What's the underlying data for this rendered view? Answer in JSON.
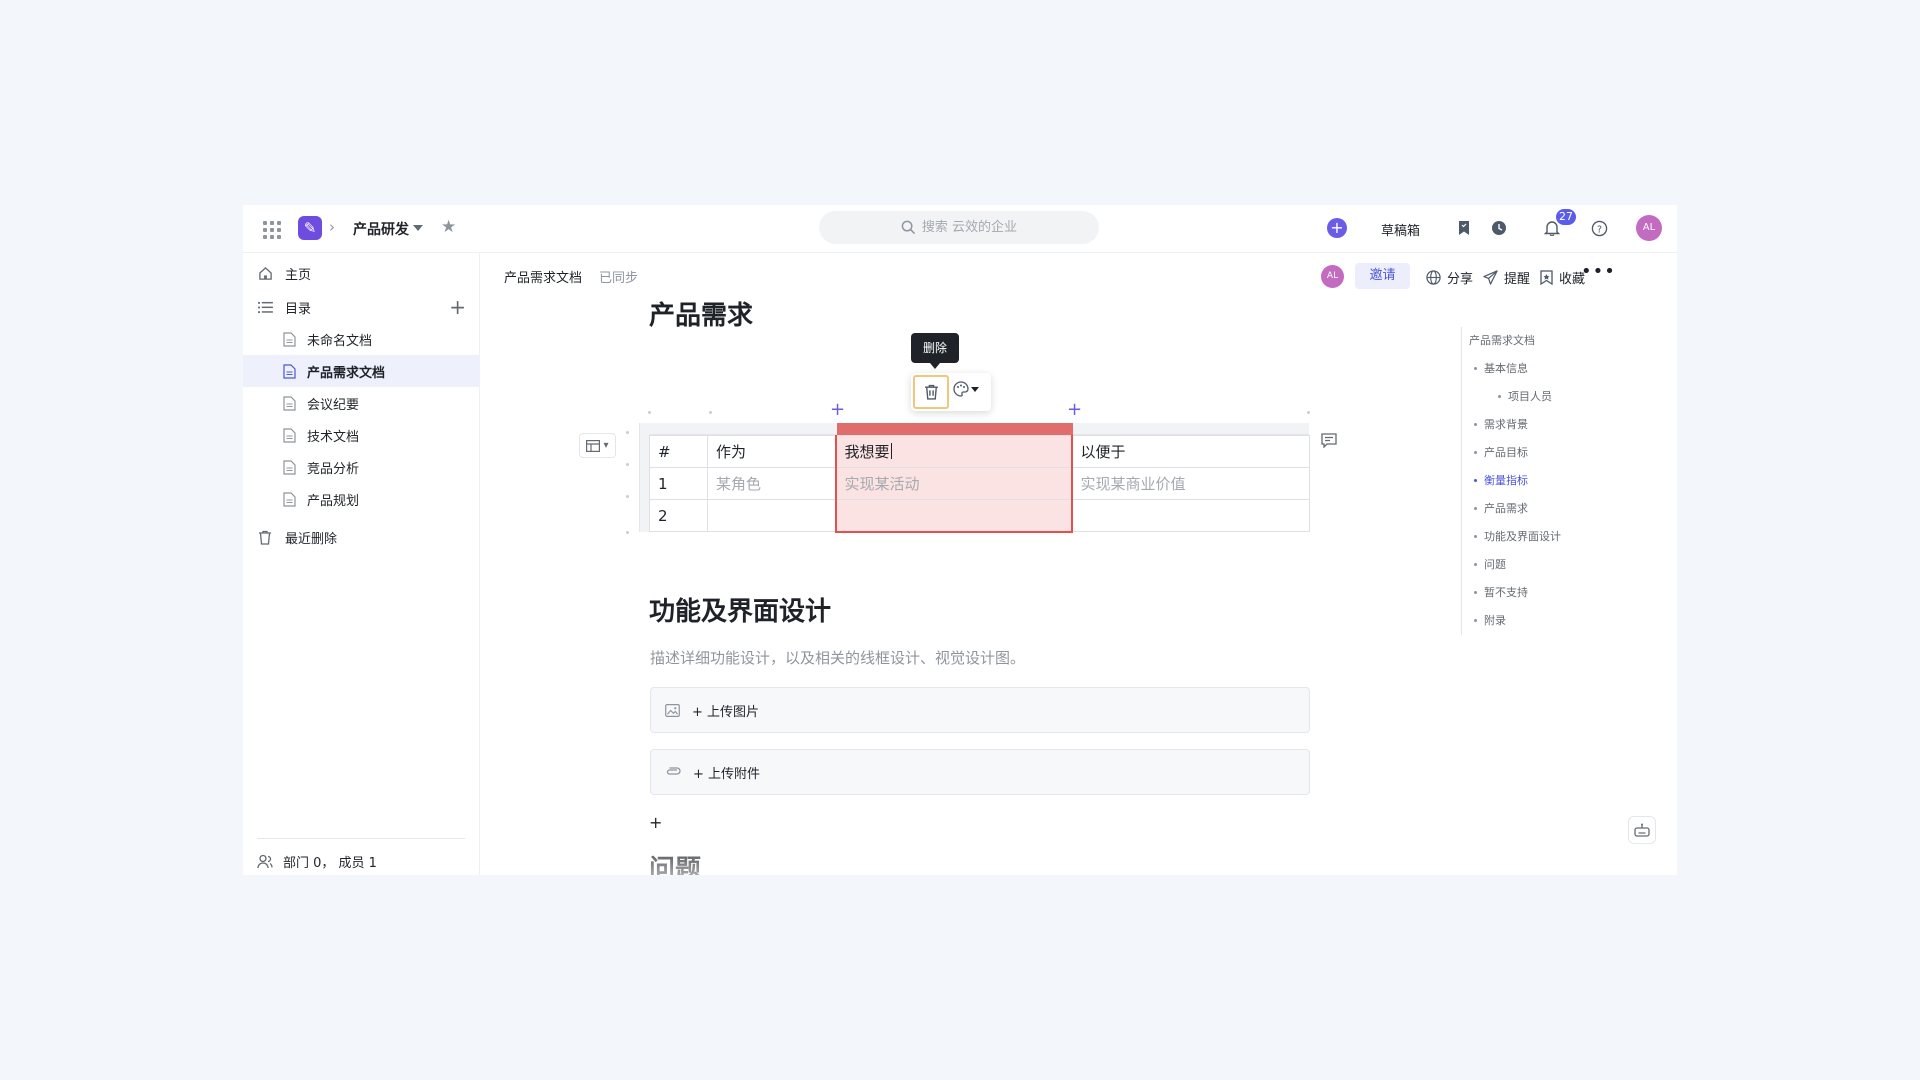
{
  "topbar": {
    "workspace": "产品研发",
    "search_placeholder": "搜索 云效的企业",
    "drafts_label": "草稿箱",
    "notification_count": "27",
    "user_initials": "AL",
    "icons": [
      "apps-grid-icon",
      "app-logo",
      "chevron-right-icon",
      "caret-down-icon",
      "star-icon",
      "search-icon",
      "add-circle-icon",
      "bookmark-icon",
      "clock-icon",
      "bell-icon",
      "help-icon"
    ]
  },
  "sidebar": {
    "home": "主页",
    "directory": "目录",
    "docs": [
      {
        "label": "未命名文档"
      },
      {
        "label": "产品需求文档"
      },
      {
        "label": "会议纪要"
      },
      {
        "label": "技术文档"
      },
      {
        "label": "竞品分析"
      },
      {
        "label": "产品规划"
      }
    ],
    "active_doc": "产品需求文档",
    "recycle": "最近删除",
    "footer": "部门 0， 成员 1"
  },
  "docbar": {
    "doc_name": "产品需求文档",
    "sync_status": "已同步",
    "avatar_initials": "AL",
    "invite": "邀请",
    "share": "分享",
    "remind": "提醒",
    "favorite": "收藏"
  },
  "content": {
    "section1_title": "产品需求",
    "table": {
      "headers": [
        "#",
        "作为",
        "我想要",
        "以便于"
      ],
      "rows": [
        [
          "1",
          "某角色",
          "实现某活动",
          "实现某商业价值"
        ],
        [
          "2",
          "",
          "",
          ""
        ]
      ],
      "selected_column": 2
    },
    "toolbar": {
      "tooltip": "删除"
    },
    "section2_title": "功能及界面设计",
    "section2_desc": "描述详细功能设计，以及相关的线框设计、视觉设计图。",
    "upload_image": "+ 上传图片",
    "upload_file": "+ 上传附件",
    "add_block": "+",
    "section3_title": "问题"
  },
  "outline": {
    "items": [
      {
        "label": "产品需求文档",
        "level": 0
      },
      {
        "label": "基本信息",
        "level": 1
      },
      {
        "label": "项目人员",
        "level": 2
      },
      {
        "label": "需求背景",
        "level": 1
      },
      {
        "label": "产品目标",
        "level": 1
      },
      {
        "label": "衡量指标",
        "level": 1
      },
      {
        "label": "产品需求",
        "level": 1
      },
      {
        "label": "功能及界面设计",
        "level": 1
      },
      {
        "label": "问题",
        "level": 1
      },
      {
        "label": "暂不支持",
        "level": 1
      },
      {
        "label": "附录",
        "level": 1
      }
    ],
    "active": "衡量指标"
  },
  "colors": {
    "accent": "#4d56d8",
    "brand": "#6e4ce0",
    "selection_red": "#e35050",
    "selection_fill": "#fbe3e3"
  }
}
